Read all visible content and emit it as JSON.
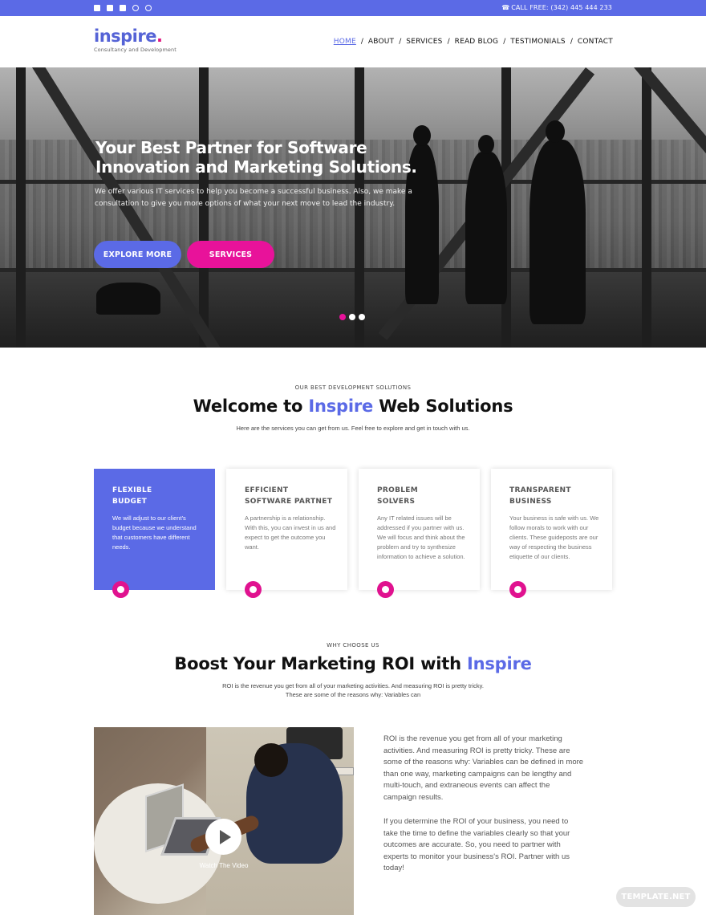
{
  "topbar": {
    "social_icons": [
      "facebook-icon",
      "twitter-icon",
      "linkedin-icon",
      "pinterest-icon",
      "instagram-icon"
    ],
    "phone_icon": "phone-icon",
    "call_label": "CALL FREE: (342) 445 444 233"
  },
  "brand": {
    "logo_text": "inspire",
    "logo_dot": ".",
    "tagline": "Consultancy and Development",
    "primary_color": "#5b6ae6",
    "accent_color": "#e8129a"
  },
  "nav": {
    "items": [
      {
        "label": "HOME",
        "active": true
      },
      {
        "label": "ABOUT",
        "active": false
      },
      {
        "label": "SERVICES",
        "active": false
      },
      {
        "label": "READ BLOG",
        "active": false
      },
      {
        "label": "TESTIMONIALS",
        "active": false
      },
      {
        "label": "CONTACT",
        "active": false
      }
    ],
    "separator": "/"
  },
  "hero": {
    "title_line1": "Your Best Partner for Software",
    "title_line2": "Innovation and Marketing Solutions.",
    "subtitle": "We offer various IT services to help you become a successful business. Also, we make a consultation to give you more options of what your next move to lead the industry.",
    "buttons": {
      "explore": "EXPLORE MORE",
      "services": "SERVICES"
    },
    "slides_total": 3,
    "active_slide": 1
  },
  "solutions": {
    "label": "OUR BEST DEVELOPMENT SOLUTIONS",
    "title_pre": "Welcome to ",
    "title_accent": "Inspire",
    "title_post": " Web Solutions",
    "description": "Here are the services you can get from us. Feel free to explore and get in touch with us.",
    "cards": [
      {
        "title_line1": "FLEXIBLE",
        "title_line2": "BUDGET",
        "text": "We will adjust to our client's budget because we understand that customers have different needs."
      },
      {
        "title_line1": "EFFICIENT",
        "title_line2": "SOFTWARE PARTNET",
        "text": "A partnership is a relationship. With this, you can invest in us and expect to get the outcome you want."
      },
      {
        "title_line1": "PROBLEM",
        "title_line2": "SOLVERS",
        "text": "Any IT related issues will be addressed if you partner with us. We will focus and think about the problem and try to synthesize information to achieve a solution."
      },
      {
        "title_line1": "TRANSPARENT",
        "title_line2": "BUSINESS",
        "text": "Your business is safe with us. We follow morals to work with our clients. These guideposts are our way of respecting the business etiquette of our clients."
      }
    ]
  },
  "why": {
    "label": "WHY CHOOSE US",
    "title_pre": "Boost Your Marketing ROI with ",
    "title_accent": "Inspire",
    "description": "ROI is the revenue you get from all of your marketing activities. And measuring ROI is pretty tricky. These are some of the reasons why: Variables can",
    "video_label": "Watch The Video",
    "paragraph1": "ROI is the revenue you get from all of your marketing activities. And measuring ROI is pretty tricky. These are some of the reasons why: Variables can be defined in more than one way, marketing campaigns can be lengthy and multi-touch, and extraneous events can affect the campaign results.",
    "paragraph2": "If you determine the ROI of your business, you need to take the time to define the variables clearly so that your outcomes are accurate. So, you need to partner with experts to monitor your business's ROI. Partner with us today!"
  },
  "watermark": "TEMPLATE.NET"
}
